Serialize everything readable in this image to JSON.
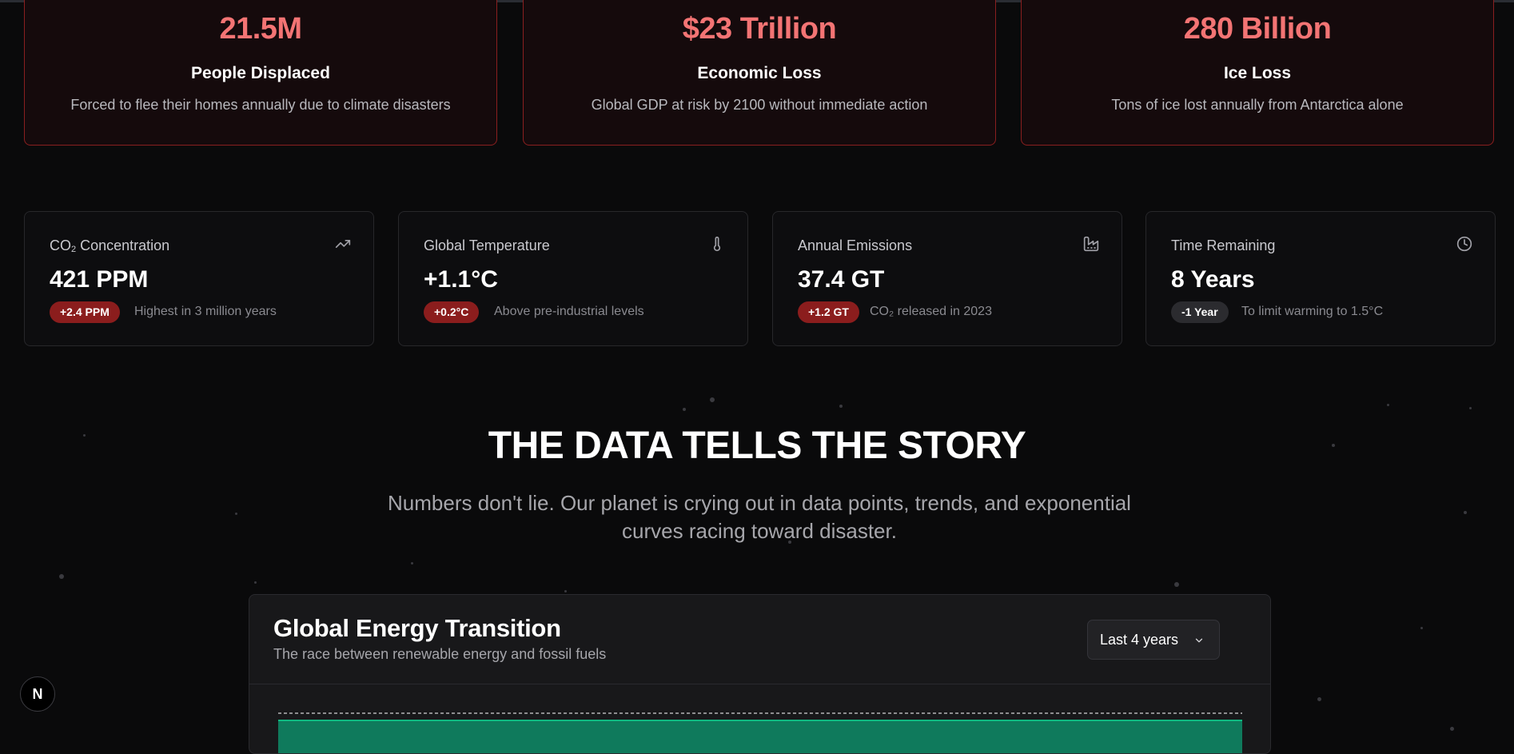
{
  "impact_cards": [
    {
      "value": "21.5M",
      "title": "People Displaced",
      "description": "Forced to flee their homes annually due to climate disasters"
    },
    {
      "value": "$23 Trillion",
      "title": "Economic Loss",
      "description": "Global GDP at risk by 2100 without immediate action"
    },
    {
      "value": "280 Billion",
      "title": "Ice Loss",
      "description": "Tons of ice lost annually from Antarctica alone"
    }
  ],
  "stat_cards": [
    {
      "label_main": "CO",
      "label_sub": "2",
      "label_rest": " Concentration",
      "value": "421 PPM",
      "badge": "+2.4 PPM",
      "note": "Highest in 3 million years",
      "icon": "trending-up-icon",
      "badge_color": "#8b1d1d"
    },
    {
      "label": "Global Temperature",
      "value": "+1.1°C",
      "badge": "+0.2°C",
      "note": "Above pre-industrial levels",
      "icon": "thermometer-icon",
      "badge_color": "#8b1d1d"
    },
    {
      "label": "Annual Emissions",
      "value": "37.4 GT",
      "badge": "+1.2 GT",
      "note": "CO₂ released in 2023",
      "icon": "factory-icon",
      "badge_color": "#8b1d1d"
    },
    {
      "label": "Time Remaining",
      "value": "8 Years",
      "badge": "-1 Year",
      "note": "To limit warming to 1.5°C",
      "icon": "clock-icon",
      "badge_color": "#2b2b2f"
    }
  ],
  "section": {
    "title": "THE DATA TELLS THE STORY",
    "subtitle": "Numbers don't lie. Our planet is crying out in data points, trends, and exponential curves racing toward disaster."
  },
  "chart_panel": {
    "title": "Global Energy Transition",
    "subtitle": "The race between renewable energy and fossil fuels",
    "range_selected": "Last 4 years"
  },
  "next_badge": "N",
  "colors": {
    "accent_red": "#f37474",
    "card_border_red": "#8a1f1f",
    "chart_green": "#10b981"
  }
}
